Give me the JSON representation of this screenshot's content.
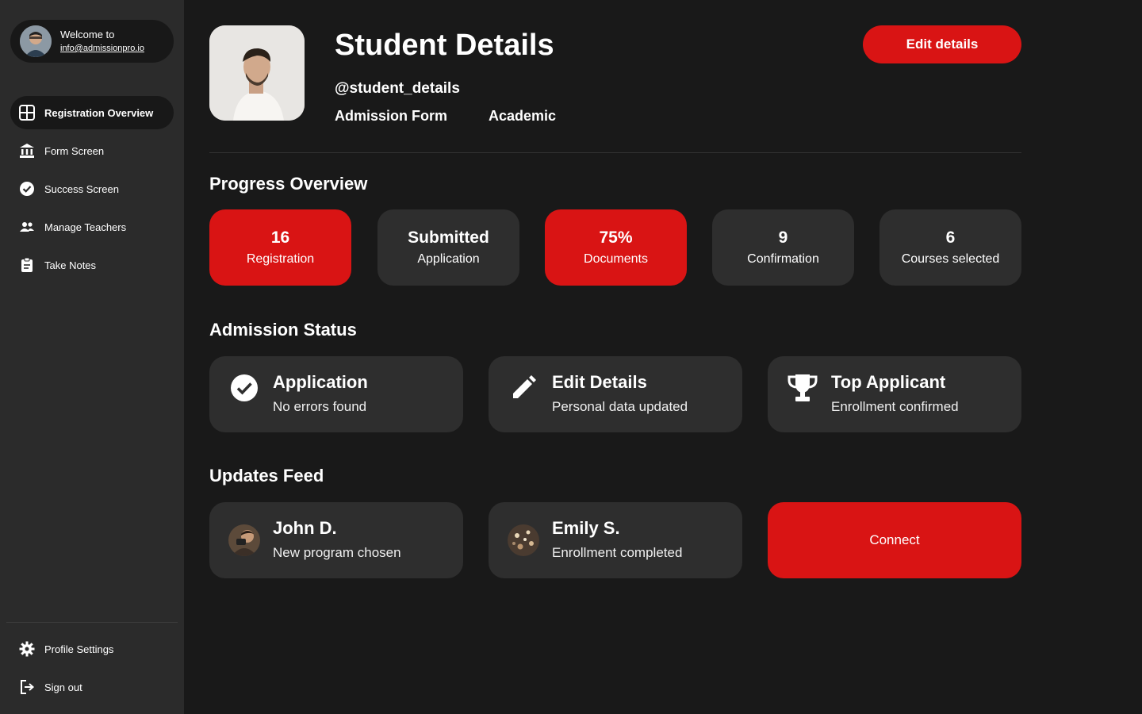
{
  "sidebar": {
    "welcome_title": "Welcome to",
    "welcome_email": "info@admissionpro.io",
    "nav": [
      {
        "label": "Registration Overview",
        "icon": "grid-icon",
        "active": true
      },
      {
        "label": "Form Screen",
        "icon": "bank-icon"
      },
      {
        "label": "Success Screen",
        "icon": "check-circle-icon"
      },
      {
        "label": "Manage Teachers",
        "icon": "people-icon"
      },
      {
        "label": "Take Notes",
        "icon": "clipboard-icon"
      }
    ],
    "bottom": [
      {
        "label": "Profile Settings",
        "icon": "gear-icon"
      },
      {
        "label": "Sign out",
        "icon": "logout-icon"
      }
    ]
  },
  "header": {
    "title": "Student Details",
    "handle": "@student_details",
    "tabs": [
      "Admission Form",
      "Academic"
    ],
    "edit_label": "Edit details"
  },
  "progress": {
    "title": "Progress Overview",
    "stats": [
      {
        "value": "16",
        "label": "Registration",
        "highlight": true
      },
      {
        "value": "Submitted",
        "label": "Application",
        "highlight": false
      },
      {
        "value": "75%",
        "label": "Documents",
        "highlight": true
      },
      {
        "value": "9",
        "label": "Confirmation",
        "highlight": false
      },
      {
        "value": "6",
        "label": "Courses selected",
        "highlight": false
      }
    ]
  },
  "status": {
    "title": "Admission Status",
    "cards": [
      {
        "title": "Application",
        "subtitle": "No errors found",
        "icon": "check-circle-icon"
      },
      {
        "title": "Edit Details",
        "subtitle": "Personal data updated",
        "icon": "pencil-icon"
      },
      {
        "title": "Top Applicant",
        "subtitle": "Enrollment confirmed",
        "icon": "trophy-icon"
      }
    ]
  },
  "feed": {
    "title": "Updates Feed",
    "items": [
      {
        "name": "John D.",
        "text": "New program chosen"
      },
      {
        "name": "Emily S.",
        "text": "Enrollment completed"
      }
    ],
    "connect_label": "Connect"
  },
  "colors": {
    "accent": "#d91414",
    "background": "#191919",
    "sidebar": "#2b2b2b",
    "card": "#2e2e2e"
  }
}
